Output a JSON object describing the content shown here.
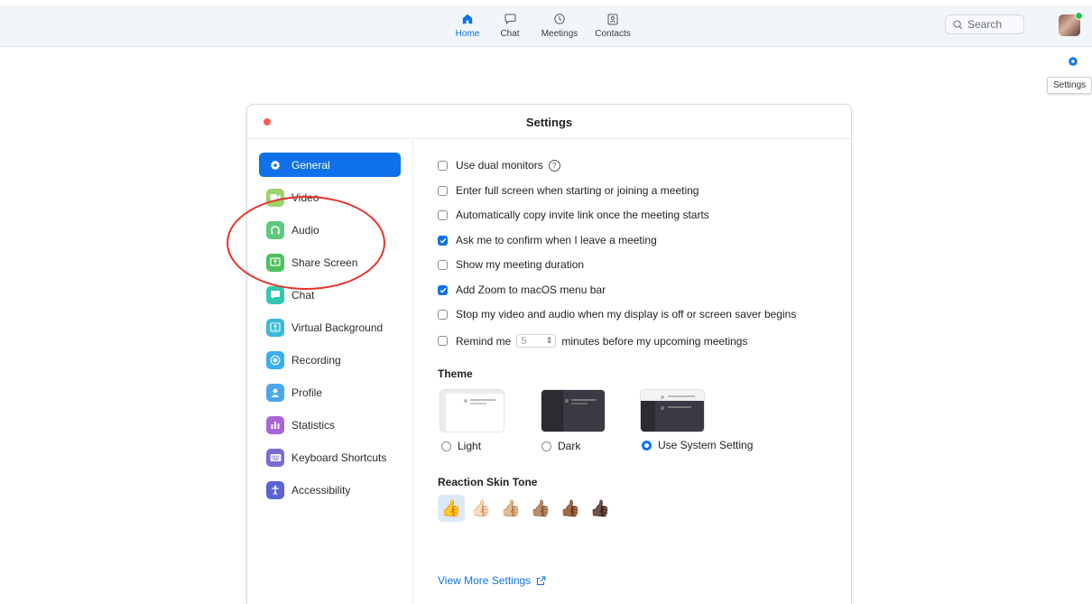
{
  "nav": {
    "items": [
      {
        "label": "Home",
        "icon": "home-icon",
        "active": true
      },
      {
        "label": "Chat",
        "icon": "chat-icon"
      },
      {
        "label": "Meetings",
        "icon": "clock-icon"
      },
      {
        "label": "Contacts",
        "icon": "contacts-icon"
      }
    ]
  },
  "search": {
    "label": "Search"
  },
  "tooltip": {
    "settings": "Settings"
  },
  "window": {
    "title": "Settings"
  },
  "sidebar": {
    "items": [
      {
        "label": "General",
        "color": "#0e71eb",
        "active": true
      },
      {
        "label": "Video",
        "color": "#9cd46b"
      },
      {
        "label": "Audio",
        "color": "#5ec97b"
      },
      {
        "label": "Share Screen",
        "color": "#4fc05f"
      },
      {
        "label": "Chat",
        "color": "#34c7b0"
      },
      {
        "label": "Virtual Background",
        "color": "#3bbad8"
      },
      {
        "label": "Recording",
        "color": "#39aef0"
      },
      {
        "label": "Profile",
        "color": "#49a6ef"
      },
      {
        "label": "Statistics",
        "color": "#a865d6"
      },
      {
        "label": "Keyboard Shortcuts",
        "color": "#7b6bd4"
      },
      {
        "label": "Accessibility",
        "color": "#5a62d6"
      }
    ]
  },
  "general": {
    "options": [
      {
        "label": "Use dual monitors",
        "checked": false
      },
      {
        "label": "Enter full screen when starting or joining a meeting",
        "checked": false
      },
      {
        "label": "Automatically copy invite link once the meeting starts",
        "checked": false
      },
      {
        "label": "Ask me to confirm when I leave a meeting",
        "checked": true
      },
      {
        "label": "Show my meeting duration",
        "checked": false
      },
      {
        "label": "Add Zoom to macOS menu bar",
        "checked": true
      },
      {
        "label": "Stop my video and audio when my display is off or screen saver begins",
        "checked": false
      }
    ],
    "remind": {
      "prefix": "Remind me",
      "value": "5",
      "suffix": "minutes before my upcoming meetings",
      "checked": false
    },
    "theme": {
      "title": "Theme",
      "options": [
        {
          "label": "Light",
          "selected": false
        },
        {
          "label": "Dark",
          "selected": false
        },
        {
          "label": "Use System Setting",
          "selected": true
        }
      ]
    },
    "skin_tone": {
      "title": "Reaction Skin Tone",
      "selected_index": 0
    },
    "more_link": "View More Settings"
  }
}
